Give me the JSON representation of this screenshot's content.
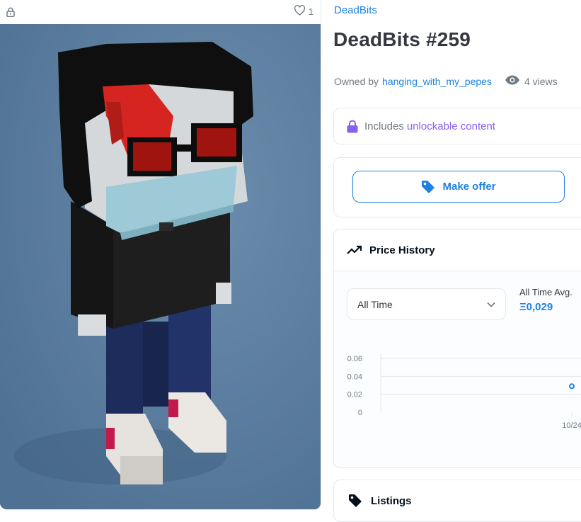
{
  "media": {
    "favorite_count": "1",
    "background_color": "#5d7fa1"
  },
  "asset": {
    "collection": "DeadBits",
    "title": "DeadBits #259",
    "owned_by_label": "Owned by",
    "owner": "hanging_with_my_pepes",
    "views": "4 views"
  },
  "unlockable": {
    "prefix": "Includes",
    "link": "unlockable content"
  },
  "offer": {
    "button_label": "Make offer"
  },
  "price_history": {
    "title": "Price History",
    "range_selected": "All Time",
    "avg_label": "All Time Avg.",
    "avg_value": "Ξ0,029"
  },
  "chart_data": {
    "type": "scatter",
    "x": [
      "10/24"
    ],
    "y": [
      0.029
    ],
    "yticks": [
      "0.06",
      "0.04",
      "0.02",
      "0"
    ],
    "ylim": [
      0,
      0.06
    ],
    "grid": true,
    "xlabel": "",
    "ylabel": ""
  },
  "listings": {
    "title": "Listings"
  },
  "colors": {
    "accent": "#2081e2",
    "unlockable": "#8a5ff0",
    "text": "#353840",
    "muted": "#707a83"
  }
}
